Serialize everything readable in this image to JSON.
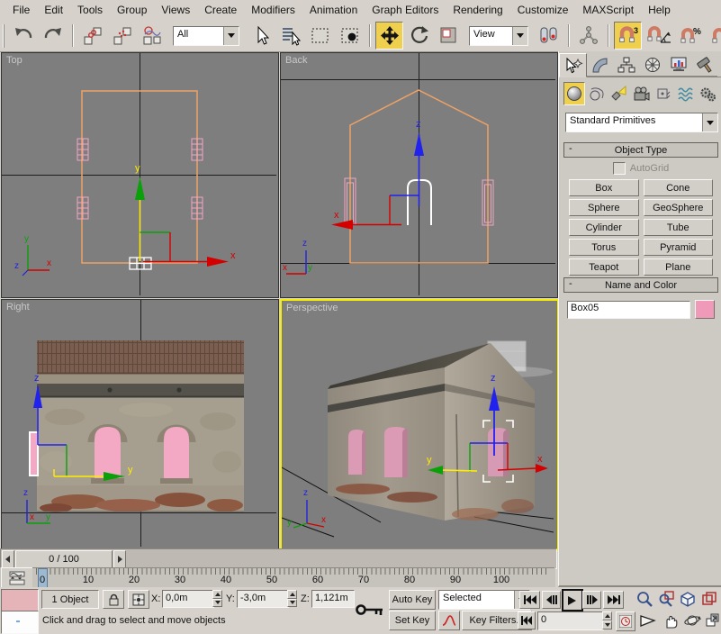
{
  "menu": {
    "items": [
      "File",
      "Edit",
      "Tools",
      "Group",
      "Views",
      "Create",
      "Modifiers",
      "Animation",
      "Graph Editors",
      "Rendering",
      "Customize",
      "MAXScript",
      "Help"
    ]
  },
  "toolbar": {
    "selection_filter_value": "All",
    "coord_system_value": "View",
    "snap_badge": "3",
    "percent_badge": "%"
  },
  "viewports": {
    "top_label": "Top",
    "back_label": "Back",
    "right_label": "Right",
    "perspective_label": "Perspective",
    "axis_x": "x",
    "axis_y": "y",
    "axis_z": "z"
  },
  "command_panel": {
    "primitives_dropdown_value": "Standard Primitives",
    "object_type": {
      "collapse": "-",
      "title": "Object Type",
      "autogrid_label": "AutoGrid",
      "buttons": [
        "Box",
        "Cone",
        "Sphere",
        "GeoSphere",
        "Cylinder",
        "Tube",
        "Torus",
        "Pyramid",
        "Teapot",
        "Plane"
      ]
    },
    "name_and_color": {
      "collapse": "-",
      "title": "Name and Color",
      "object_name": "Box05",
      "object_color": "#ef9ab8"
    }
  },
  "time_controls": {
    "slider_value": "0 / 100",
    "ticks": [
      "0",
      "10",
      "20",
      "30",
      "40",
      "50",
      "60",
      "70",
      "80",
      "90",
      "100"
    ],
    "auto_key_label": "Auto Key",
    "set_key_label": "Set Key",
    "key_filter_mode": "Selected",
    "key_filters_label": "Key Filters...",
    "frame_value": "0"
  },
  "status_bar": {
    "selection_count": "1 Object",
    "x_label": "X:",
    "y_label": "Y:",
    "z_label": "Z:",
    "x_value": "0,0m",
    "y_value": "-3,0m",
    "z_value": "1,121m",
    "prompt": "Click and drag to select and move objects"
  },
  "colors": {
    "active_tool_yellow": "#eecf4e",
    "active_viewport_border": "#f8ef00",
    "wireframe_orange": "#eda266",
    "object_pink": "#f2a6c2"
  }
}
